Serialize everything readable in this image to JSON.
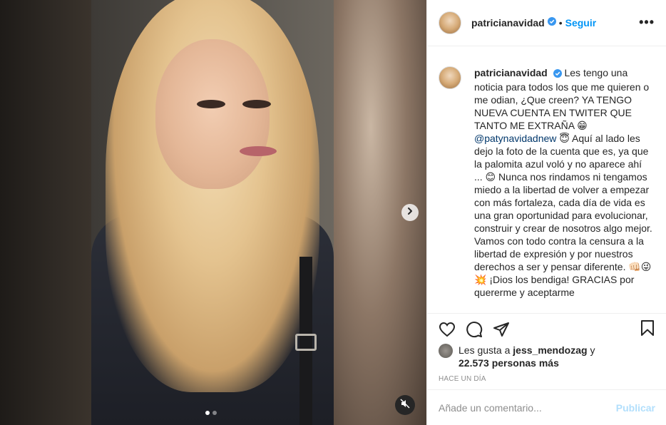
{
  "post": {
    "carousel": {
      "slide_count": 2,
      "active_index": 0
    },
    "icons": {
      "next": "chevron-right-icon",
      "mute": "speaker-muted-icon"
    }
  },
  "header": {
    "username": "patricianavidad",
    "verified_icon": "verified-badge-icon",
    "separator": "•",
    "follow_label": "Seguir",
    "more_label": "•••"
  },
  "caption": {
    "username": "patricianavidad",
    "text_part1": "Les tengo una noticia para todos los que me quieren o me odian, ¿Que creen? YA TENGO NUEVA CUENTA EN TWITER QUE TANTO ME EXTRAÑA 😁",
    "mention": "@patynavidadnew",
    "text_part2": "😇 Aquí al lado les dejo la foto de la cuenta que es, ya que la palomita azul voló y no aparece ahí ... 😊 Nunca nos rindamos ni tengamos miedo a la libertad de volver a empezar con más fortaleza, cada día de vida es una gran oportunidad para evolucionar, construir y crear de nosotros algo mejor. Vamos con todo contra la censura a la libertad de expresión y por nuestros derechos a ser y pensar diferente. 👊🏻😜💥 ¡Dios los bendiga! GRACIAS por quererme y aceptarme"
  },
  "actions": {
    "like_icon": "heart-icon",
    "comment_icon": "comment-bubble-icon",
    "share_icon": "paper-plane-icon",
    "save_icon": "bookmark-icon"
  },
  "likes": {
    "prefix": "Les gusta a",
    "user": "jess_mendozag",
    "joiner": "y",
    "count": "22.573 personas más"
  },
  "timestamp": "HACE UN DÍA",
  "comment_box": {
    "placeholder": "Añade un comentario...",
    "publish_label": "Publicar"
  },
  "colors": {
    "accent": "#0095f6",
    "publish_disabled": "#b2dffc",
    "secondary_text": "#8e8e8e",
    "mention": "#00376b"
  }
}
